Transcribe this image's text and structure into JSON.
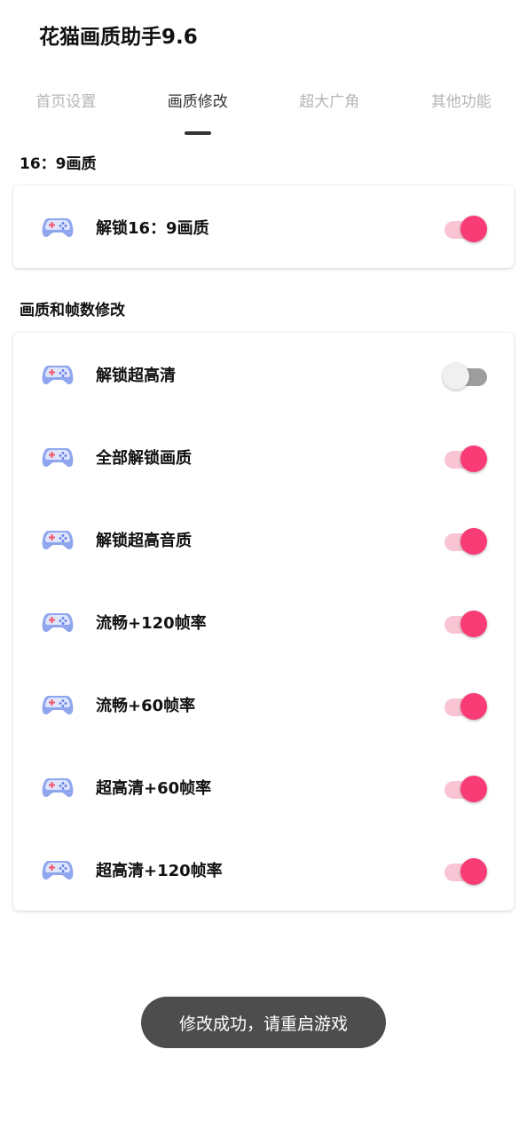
{
  "app": {
    "title": "花猫画质助手9.6"
  },
  "tabs": [
    {
      "label": "首页设置",
      "active": false
    },
    {
      "label": "画质修改",
      "active": true
    },
    {
      "label": "超大广角",
      "active": false
    },
    {
      "label": "其他功能",
      "active": false
    }
  ],
  "sections": [
    {
      "title": "16：9画质",
      "items": [
        {
          "label": "解锁16：9画质",
          "on": true
        }
      ]
    },
    {
      "title": "画质和帧数修改",
      "items": [
        {
          "label": "解锁超高清",
          "on": false
        },
        {
          "label": "全部解锁画质",
          "on": true
        },
        {
          "label": "解锁超高音质",
          "on": true
        },
        {
          "label": "流畅+120帧率",
          "on": true
        },
        {
          "label": "流畅+60帧率",
          "on": true
        },
        {
          "label": "超高清+60帧率",
          "on": true
        },
        {
          "label": "超高清+120帧率",
          "on": true
        }
      ]
    }
  ],
  "toast": {
    "message": "修改成功，请重启游戏"
  },
  "colors": {
    "accent": "#fa3c76",
    "accent_track": "#f9c5d5",
    "off_track": "#9e9e9e",
    "off_thumb": "#f0f0f0",
    "toast_bg": "#4d4d4d"
  },
  "icons": {
    "row_icon": "gamepad-icon"
  }
}
